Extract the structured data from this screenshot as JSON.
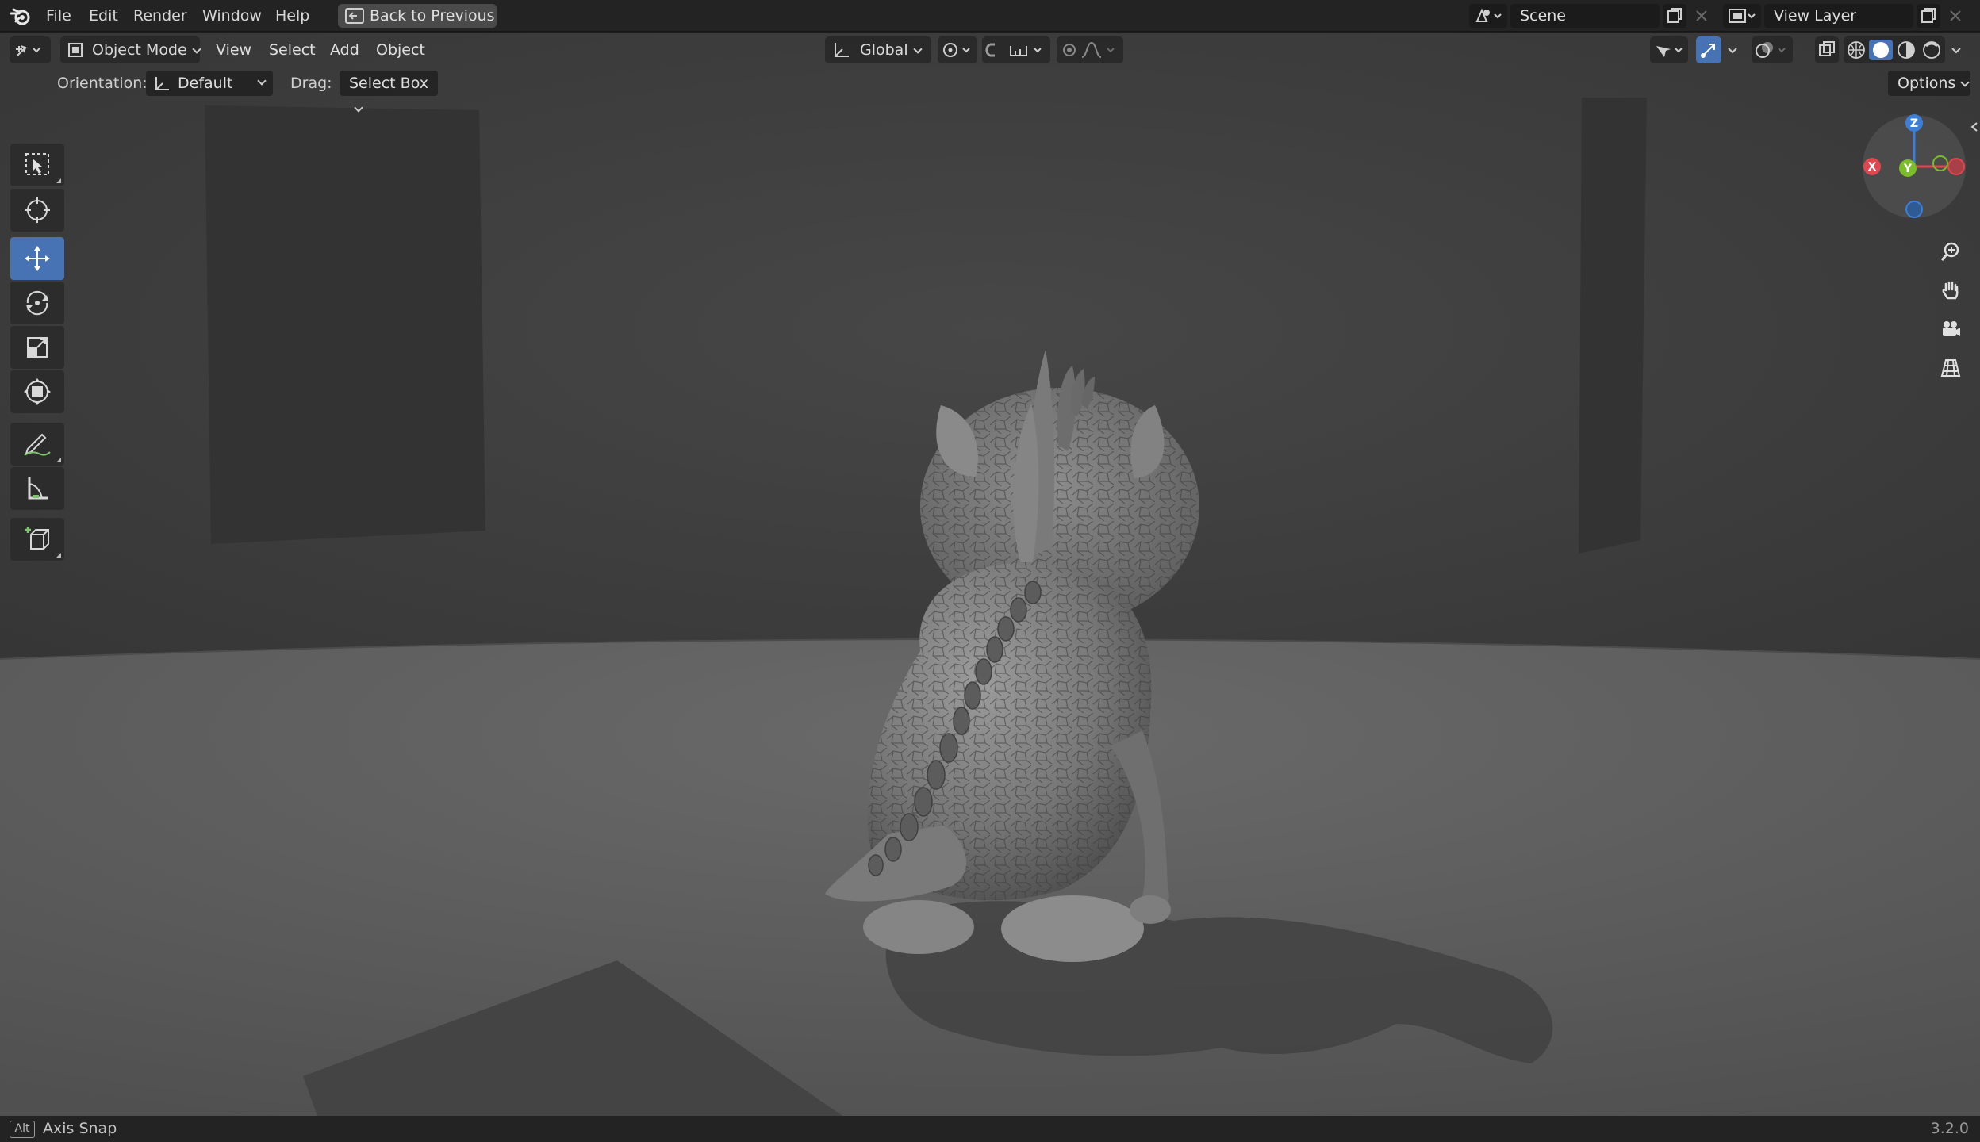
{
  "menu": {
    "file": "File",
    "edit": "Edit",
    "render": "Render",
    "window": "Window",
    "help": "Help",
    "back_to_previous": "Back to Previous"
  },
  "scene": {
    "name": "Scene"
  },
  "view_layer": {
    "name": "View Layer"
  },
  "viewport_header": {
    "mode": "Object Mode",
    "view": "View",
    "select": "Select",
    "add": "Add",
    "object": "Object",
    "transform_orientation": "Global"
  },
  "tool_settings": {
    "orientation_label": "Orientation:",
    "orientation_value": "Default",
    "drag_label": "Drag:",
    "drag_value": "Select Box",
    "options": "Options"
  },
  "toolbar": {
    "tools": [
      "select-box",
      "cursor",
      "move",
      "rotate",
      "scale",
      "transform",
      "annotate",
      "measure",
      "add-cube"
    ],
    "active_tool": "move"
  },
  "gizmo": {
    "x": "X",
    "y": "Y",
    "z": "Z"
  },
  "shading": {
    "active": "solid"
  },
  "statusbar": {
    "key": "Alt",
    "hint": "Axis Snap",
    "version": "3.2.0"
  },
  "colors": {
    "accent": "#4772b3",
    "axis_x": "#e0474f",
    "axis_y": "#7bbd2a",
    "axis_z": "#3d7fd6"
  }
}
